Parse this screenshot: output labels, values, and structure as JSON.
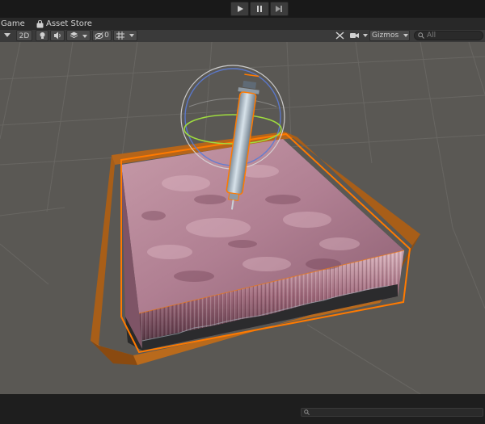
{
  "play_controls": {
    "play_icon": "play-icon",
    "pause_icon": "pause-icon",
    "step_icon": "step-icon"
  },
  "tabs": {
    "game": "Game",
    "asset_store": "Asset Store",
    "asset_store_icon": "shopping-bag-icon"
  },
  "toolbar": {
    "mode_2d": "2D",
    "hidden_count": "0",
    "gizmos": "Gizmos",
    "search_placeholder": "All"
  },
  "scene": {
    "description_icons": [
      "light-icon",
      "audio-icon",
      "effects-icon",
      "visibility-icon",
      "grid-icon",
      "tools-icon",
      "camera-icon"
    ],
    "selection_color": "#ff7a00",
    "background_color": "#5a5854"
  }
}
